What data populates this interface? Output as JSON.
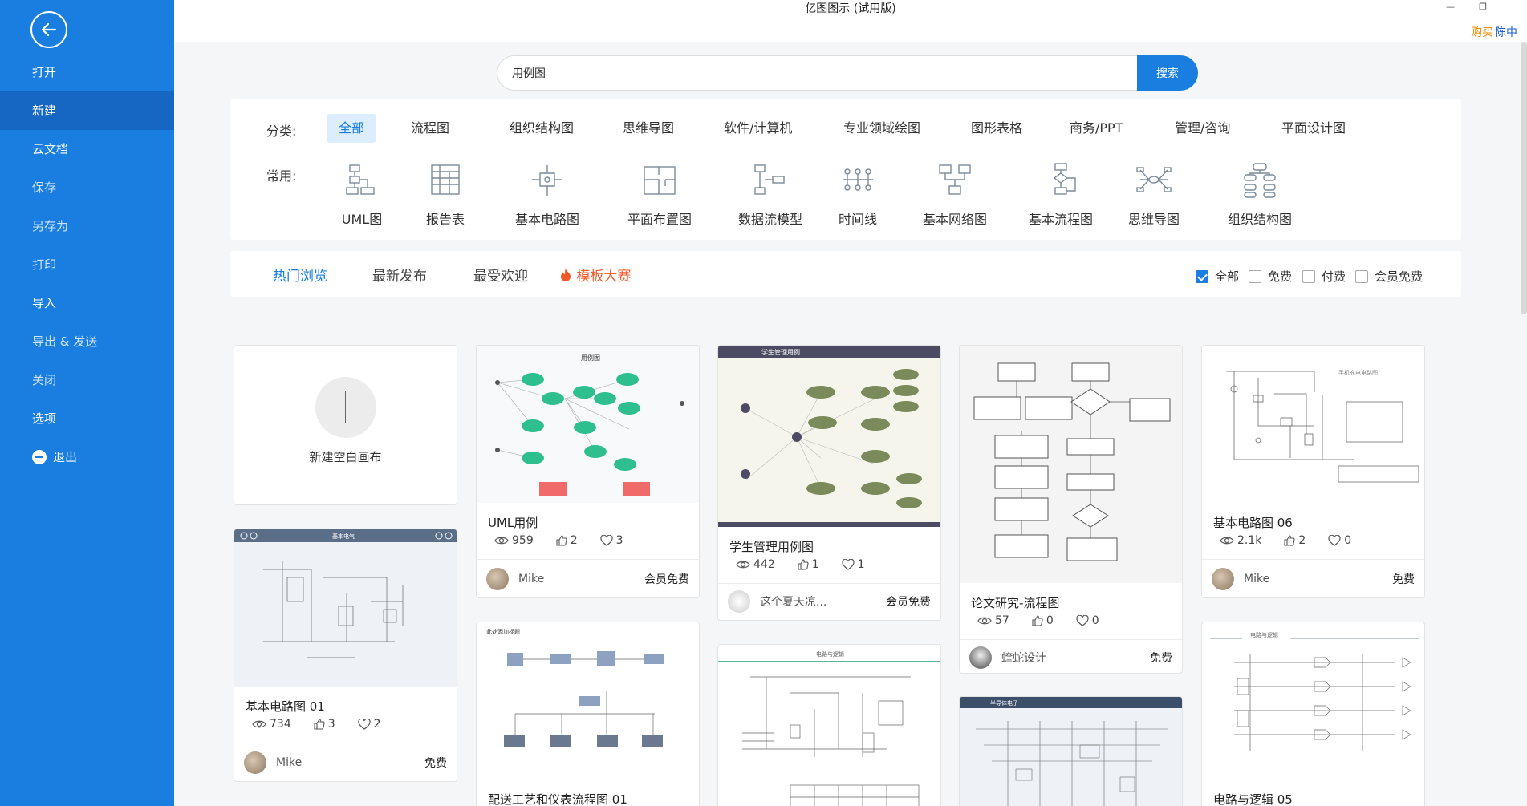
{
  "app": {
    "title": "亿图图示 (试用版)",
    "buy": "购买",
    "user": "陈中"
  },
  "window": {
    "minimize": "—",
    "restore": "❐"
  },
  "sidebar": {
    "items": [
      {
        "label": "打开"
      },
      {
        "label": "新建"
      },
      {
        "label": "云文档"
      },
      {
        "label": "保存"
      },
      {
        "label": "另存为"
      },
      {
        "label": "打印"
      },
      {
        "label": "导入"
      },
      {
        "label": "导出 & 发送"
      },
      {
        "label": "关闭"
      },
      {
        "label": "选项"
      },
      {
        "label": "退出"
      }
    ]
  },
  "search": {
    "value": "用例图",
    "button": "搜索"
  },
  "categories": {
    "label": "分类:",
    "items": [
      "全部",
      "流程图",
      "组织结构图",
      "思维导图",
      "软件/计算机",
      "专业领域绘图",
      "图形表格",
      "商务/PPT",
      "管理/咨询",
      "平面设计图"
    ]
  },
  "common": {
    "label": "常用:",
    "items": [
      {
        "label": "UML图",
        "icon": "uml-icon"
      },
      {
        "label": "报告表",
        "icon": "report-icon"
      },
      {
        "label": "基本电路图",
        "icon": "circuit-icon"
      },
      {
        "label": "平面布置图",
        "icon": "floorplan-icon"
      },
      {
        "label": "数据流模型",
        "icon": "dataflow-icon"
      },
      {
        "label": "时间线",
        "icon": "timeline-icon"
      },
      {
        "label": "基本网络图",
        "icon": "network-icon"
      },
      {
        "label": "基本流程图",
        "icon": "flowchart-icon"
      },
      {
        "label": "思维导图",
        "icon": "mindmap-icon"
      },
      {
        "label": "组织结构图",
        "icon": "orgchart-icon"
      }
    ]
  },
  "tabs": [
    "热门浏览",
    "最新发布",
    "最受欢迎",
    "模板大赛"
  ],
  "filters": [
    {
      "label": "全部",
      "checked": true
    },
    {
      "label": "免费",
      "checked": false
    },
    {
      "label": "付费",
      "checked": false
    },
    {
      "label": "会员免费",
      "checked": false
    }
  ],
  "blank_card": {
    "label": "新建空白画布"
  },
  "cards": [
    {
      "title": "UML用例",
      "views": "959",
      "likes": "2",
      "favs": "3",
      "author": "Mike",
      "price": "会员免费"
    },
    {
      "title": "学生管理用例图",
      "views": "442",
      "likes": "1",
      "favs": "1",
      "author": "这个夏天凉...",
      "price": "会员免费"
    },
    {
      "title": "论文研究-流程图",
      "views": "57",
      "likes": "0",
      "favs": "0",
      "author": "蝰蛇设计",
      "price": "免费"
    },
    {
      "title": "基本电路图 06",
      "views": "2.1k",
      "likes": "2",
      "favs": "0",
      "author": "Mike",
      "price": "免费"
    },
    {
      "title": "基本电路图 01",
      "views": "734",
      "likes": "3",
      "favs": "2",
      "author": "Mike",
      "price": "免费"
    },
    {
      "title": "配送工艺和仪表流程图 01"
    },
    {
      "title": "电路与逻辑 05"
    }
  ],
  "thumb_text": {
    "uml": "用例图",
    "student": "学生管理用例",
    "circuit01": "基本电气",
    "delivery": "此处添加标题",
    "circuit06": "手机充电电路图",
    "logic": "电路与逻辑",
    "logic2": "电路与逻辑",
    "cpu": "半导体电子"
  },
  "colors": {
    "sidebar": "#1a7ee0",
    "accent": "#1a7ee0",
    "fire": "#f05a28",
    "buy": "#f08a00"
  }
}
